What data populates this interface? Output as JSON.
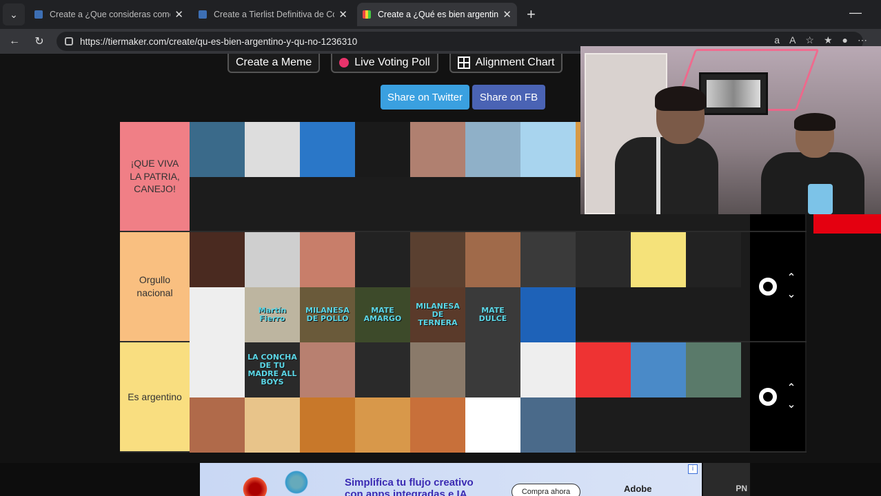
{
  "browser": {
    "tabs": [
      {
        "title": "Create a ¿Que consideras como ir",
        "active": false
      },
      {
        "title": "Create a Tierlist Definitiva de Con",
        "active": false
      },
      {
        "title": "Create a ¿Qué es bien argentino y",
        "active": true
      }
    ],
    "url": "https://tiermaker.com/create/qu-es-bien-argentino-y-qu-no-1236310",
    "new_tab": "+"
  },
  "page": {
    "buttons": {
      "meme": "Create a Meme",
      "poll": "Live Voting Poll",
      "alignment": "Alignment Chart"
    },
    "share": {
      "twitter": "Share on Twitter",
      "fb": "Share on FB"
    }
  },
  "tiers": [
    {
      "label": "¡QUE VIVA LA PATRIA, CANEJO!",
      "color": "#f07f86",
      "height": 160,
      "items": [
        {
          "name": "islas-malvinas",
          "bg": "#3a6a8a"
        },
        {
          "name": "san-martin",
          "bg": "#ddd"
        },
        {
          "name": "maradona",
          "bg": "#2a77c8"
        },
        {
          "name": "messi",
          "bg": "#1a1a1a"
        },
        {
          "name": "singer-portrait",
          "bg": "#b08070"
        },
        {
          "name": "iguazu-falls",
          "bg": "#8fb0c8"
        },
        {
          "name": "perito-moreno",
          "bg": "#a8d4ee"
        },
        {
          "name": "empanada",
          "bg": "#d89a45"
        }
      ]
    },
    {
      "label": "Orgullo nacional",
      "color": "#f9bf80",
      "height": 160,
      "items": [
        {
          "name": "asado",
          "bg": "#4a2a20"
        },
        {
          "name": "borges",
          "bg": "#cfcfcf"
        },
        {
          "name": "casa-rosada",
          "bg": "#c87e6a"
        },
        {
          "name": "fernet-bottle",
          "bg": "#222"
        },
        {
          "name": "actor-portrait",
          "bg": "#5a4030"
        },
        {
          "name": "curly-hair-man",
          "bg": "#a06a4a"
        },
        {
          "name": "bearded-man",
          "bg": "#3a3a3a"
        },
        {
          "name": "band-photo",
          "bg": "#2a2a2a"
        },
        {
          "name": "cartoon-character",
          "bg": "#f5e27a"
        },
        {
          "name": "dulce-de-leche",
          "bg": "#222"
        },
        {
          "name": "alfajor-box",
          "bg": "#eee"
        },
        {
          "name": "martin-fierro",
          "bg": "#bdb5a0",
          "caption": "Martín Fierro"
        },
        {
          "name": "milanesa-pollo",
          "bg": "#6a5a3a",
          "caption": "MILANESA DE POLLO"
        },
        {
          "name": "mate-amargo",
          "bg": "#3d4a2a",
          "caption": "MATE AMARGO"
        },
        {
          "name": "milanesa-ternera",
          "bg": "#5a3a2a",
          "caption": "MILANESA DE TERNERA"
        },
        {
          "name": "mate-dulce",
          "bg": "#3a3a3a",
          "caption": "MATE DULCE"
        },
        {
          "name": "rocklets-bag",
          "bg": "#1e62b8"
        }
      ]
    },
    {
      "label": "Es argentino",
      "color": "#f9de80",
      "height": 160,
      "items": [
        {
          "name": "alfajores-white",
          "bg": "#eee"
        },
        {
          "name": "la-concha-de-tu-madre",
          "bg": "#2a2a2a",
          "caption": "LA CONCHA DE TU MADRE ALL BOYS"
        },
        {
          "name": "wrestler-blonde",
          "bg": "#b88070"
        },
        {
          "name": "masked-wrestler",
          "bg": "#2a2a2a"
        },
        {
          "name": "long-hair-man",
          "bg": "#8a7a6a"
        },
        {
          "name": "streamer-cap",
          "bg": "#3a3a3a"
        },
        {
          "name": "magazine-cover",
          "bg": "#eee"
        },
        {
          "name": "paco-product",
          "bg": "#e33"
        },
        {
          "name": "exquisita-box",
          "bg": "#4a8ac8"
        },
        {
          "name": "video-man",
          "bg": "#5a7a6a"
        },
        {
          "name": "traditional-dancers",
          "bg": "#b06a4a"
        },
        {
          "name": "cookies",
          "bg": "#e8c48a"
        },
        {
          "name": "croissants",
          "bg": "#c8782a"
        },
        {
          "name": "pastries",
          "bg": "#d8984a"
        },
        {
          "name": "pepas",
          "bg": "#c8703a"
        },
        {
          "name": "river-plate-badge",
          "bg": "#fff"
        },
        {
          "name": "tv-presenter",
          "bg": "#4a6a8a"
        }
      ]
    }
  ],
  "ad": {
    "text_line1": "Simplifica tu flujo creativo",
    "text_line2": "con apps integradas e IA",
    "cta": "Compra ahora",
    "brand": "Adobe",
    "close": "i",
    "corner": "PN"
  }
}
